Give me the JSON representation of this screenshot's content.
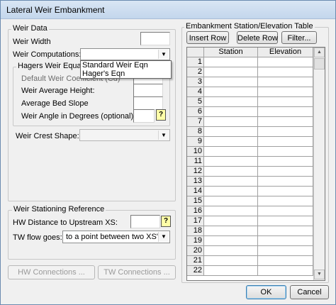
{
  "window": {
    "title": "Lateral Weir Embankment"
  },
  "weir_data": {
    "legend": "Weir Data",
    "width_label": "Weir Width",
    "width_value": "",
    "computations_label": "Weir Computations:",
    "computations_value": "",
    "computations_options": [
      "Standard Weir Eqn",
      "Hager's Eqn"
    ],
    "hager": {
      "legend": "Hagers Weir Equation",
      "coeff_label": "Default Weir Coefficient (Cd)",
      "coeff_value": "",
      "avg_height_label": "Weir Average Height:",
      "avg_height_value": "",
      "bed_slope_label": "Average Bed Slope",
      "bed_slope_value": "",
      "angle_label": "Weir Angle in Degrees (optional):",
      "angle_value": "",
      "help_glyph": "?"
    },
    "crest_label": "Weir Crest Shape:",
    "crest_value": ""
  },
  "stationing": {
    "legend": "Weir Stationing Reference",
    "hw_label": "HW Distance to Upstream XS:",
    "hw_value": "",
    "help_glyph": "?",
    "tw_label": "TW flow goes:",
    "tw_value": "to a point between two XS's"
  },
  "connections": {
    "hw_label": "HW Connections ...",
    "tw_label": "TW Connections ..."
  },
  "table": {
    "legend": "Embankment Station/Elevation Table",
    "insert_label": "Insert Row",
    "delete_label": "Delete Row",
    "filter_label": "Filter...",
    "columns": [
      "Station",
      "Elevation"
    ],
    "rows": [
      "1",
      "2",
      "3",
      "4",
      "5",
      "6",
      "7",
      "8",
      "9",
      "10",
      "11",
      "12",
      "13",
      "14",
      "15",
      "16",
      "17",
      "18",
      "19",
      "20",
      "21",
      "22"
    ]
  },
  "footer": {
    "ok_label": "OK",
    "cancel_label": "Cancel"
  }
}
